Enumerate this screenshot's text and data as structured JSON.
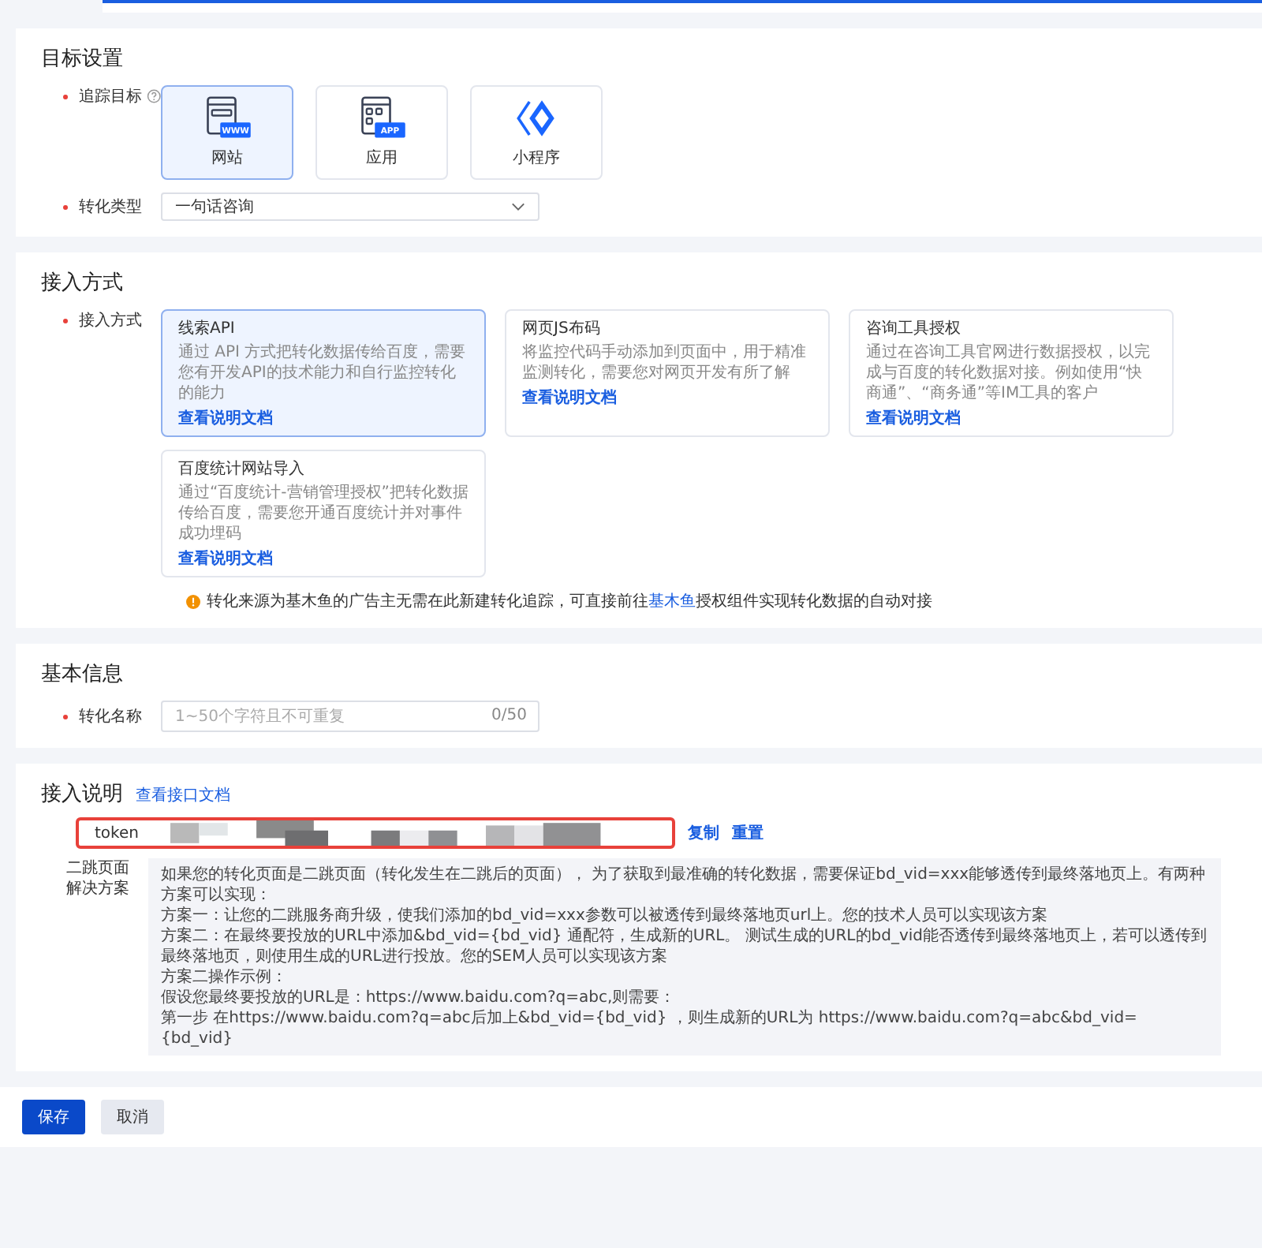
{
  "target_settings": {
    "title": "目标设置",
    "tracking_target": {
      "label": "追踪目标",
      "required": true,
      "options": [
        {
          "label": "网站",
          "kind": "website",
          "badge": "WWW",
          "selected": true
        },
        {
          "label": "应用",
          "kind": "app",
          "badge": "APP",
          "selected": false
        },
        {
          "label": "小程序",
          "kind": "miniprogram",
          "selected": false
        }
      ]
    },
    "conversion_type": {
      "label": "转化类型",
      "required": true,
      "value": "一句话咨询"
    }
  },
  "access_method": {
    "title": "接入方式",
    "label": "接入方式",
    "required": true,
    "options": [
      {
        "title": "线索API",
        "description": "通过 API 方式把转化数据传给百度，需要您有开发API的技术能力和自行监控转化的能力",
        "link": "查看说明文档",
        "selected": true
      },
      {
        "title": "网页JS布码",
        "description": "将监控代码手动添加到页面中，用于精准监测转化，需要您对网页开发有所了解",
        "link": "查看说明文档",
        "selected": false
      },
      {
        "title": "咨询工具授权",
        "description": "通过在咨询工具官网进行数据授权，以完成与百度的转化数据对接。例如使用“快商通”、“商务通”等IM工具的客户",
        "link": "查看说明文档",
        "selected": false
      },
      {
        "title": "百度统计网站导入",
        "description": "通过“百度统计-营销管理授权”把转化数据传给百度，需要您开通百度统计并对事件成功埋码",
        "link": "查看说明文档",
        "selected": false
      }
    ],
    "notice": {
      "before": "转化来源为基木鱼的广告主无需在此新建转化追踪，可直接前往",
      "link": "基木鱼",
      "after": "授权组件实现转化数据的自动对接"
    }
  },
  "basic_info": {
    "title": "基本信息",
    "name_field": {
      "label": "转化名称",
      "required": true,
      "placeholder": "1~50个字符且不可重复",
      "counter": "0/50"
    }
  },
  "access_notes": {
    "title": "接入说明",
    "doc_link": "查看接口文档",
    "token": {
      "label": "token",
      "actions": [
        "复制",
        "重置"
      ]
    },
    "solution": {
      "label": "二跳页面解决方案",
      "lines": [
        "如果您的转化页面是二跳页面（转化发生在二跳后的页面）， 为了获取到最准确的转化数据，需要保证bd_vid=xxx能够透传到最终落地页上。有两种方案可以实现：",
        "方案一：让您的二跳服务商升级，使我们添加的bd_vid=xxx参数可以被透传到最终落地页url上。您的技术人员可以实现该方案",
        "方案二：在最终要投放的URL中添加&bd_vid={bd_vid} 通配符，生成新的URL。 测试生成的URL的bd_vid能否透传到最终落地页上，若可以透传到最终落地页，则使用生成的URL进行投放。您的SEM人员可以实现该方案",
        "方案二操作示例：",
        "假设您最终要投放的URL是：https://www.baidu.com?q=abc,则需要：",
        "第一步 在https://www.baidu.com?q=abc后加上&bd_vid={bd_vid} ，则生成新的URL为 https://www.baidu.com?q=abc&bd_vid={bd_vid}"
      ]
    }
  },
  "buttons": [
    {
      "label": "保存",
      "kind": "primary"
    },
    {
      "label": "取消",
      "kind": "default"
    }
  ]
}
